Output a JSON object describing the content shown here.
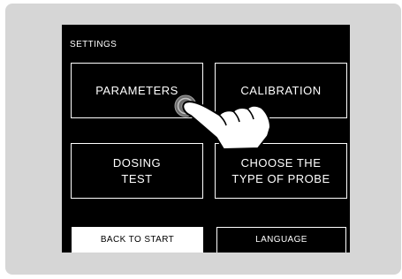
{
  "screen": {
    "title": "SETTINGS",
    "buttons": {
      "parameters": "PARAMETERS",
      "calibration": "CALIBRATION",
      "dosing_line1": "DOSING",
      "dosing_line2": "TEST",
      "probe_line1": "CHOOSE THE",
      "probe_line2": "TYPE OF PROBE",
      "back": "BACK TO START",
      "language": "LANGUAGE"
    }
  },
  "overlay": {
    "icon": "pointing-hand-icon",
    "touch_indicator": "touch-ripple-icon"
  },
  "colors": {
    "device": "#d6d6d6",
    "screen": "#000000",
    "text": "#ffffff"
  }
}
